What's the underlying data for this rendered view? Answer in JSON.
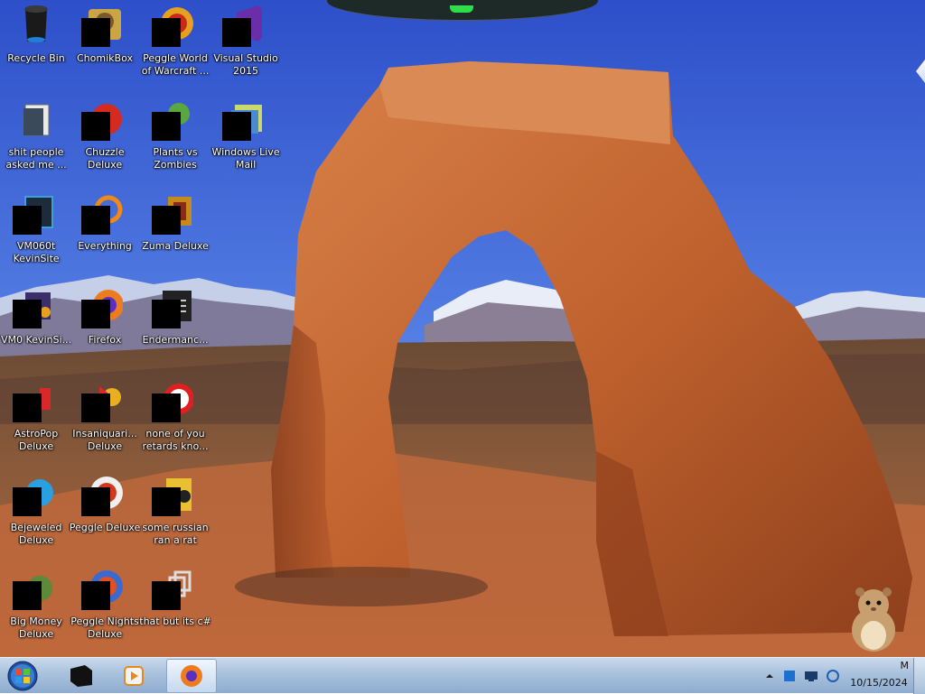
{
  "desktop": {
    "icons": [
      {
        "label": "Recycle Bin"
      },
      {
        "label": "ChomikBox"
      },
      {
        "label": "Peggle World of Warcraft ..."
      },
      {
        "label": "Visual Studio 2015"
      },
      {
        "label": "shit people asked me ..."
      },
      {
        "label": "Chuzzle Deluxe"
      },
      {
        "label": "Plants vs Zombies"
      },
      {
        "label": "Windows Live Mail"
      },
      {
        "label": "VM060t KevinSite"
      },
      {
        "label": "Everything"
      },
      {
        "label": "Zuma Deluxe"
      },
      {
        "label": "VM0 KevinSi..."
      },
      {
        "label": "Firefox"
      },
      {
        "label": "Endermanc..."
      },
      {
        "label": "AstroPop Deluxe"
      },
      {
        "label": "Insaniquari... Deluxe"
      },
      {
        "label": "none of you retards kno..."
      },
      {
        "label": "Bejeweled Deluxe"
      },
      {
        "label": "Peggle Deluxe"
      },
      {
        "label": "some russian ran a rat"
      },
      {
        "label": "Big Money Deluxe"
      },
      {
        "label": "Peggle Nights Deluxe"
      },
      {
        "label": "that but its c#"
      }
    ]
  },
  "taskbar": {
    "clock_time": "M",
    "clock_date": "10/15/2024"
  },
  "colors": {
    "sky": "#3a5fd0",
    "taskbar": "#a9c1dd",
    "rock": "#c0622e"
  }
}
